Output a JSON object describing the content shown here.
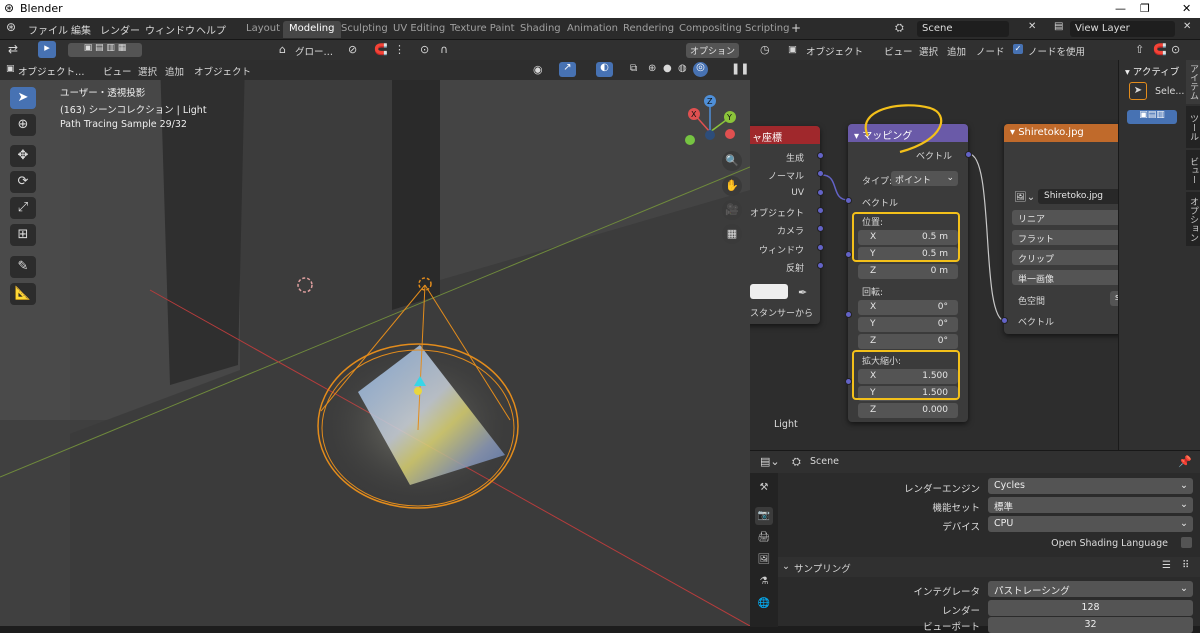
{
  "window": {
    "title": "Blender",
    "min": "—",
    "max": "❐",
    "close": "✕"
  },
  "menus": [
    "ファイル",
    "編集",
    "レンダー",
    "ウィンドウ",
    "ヘルプ"
  ],
  "workspace_tabs": [
    "Layout",
    "Modeling",
    "Sculpting",
    "UV Editing",
    "Texture Paint",
    "Shading",
    "Animation",
    "Rendering",
    "Compositing",
    "Scripting"
  ],
  "active_tab": "Modeling",
  "scene": {
    "name": "Scene",
    "view_layer": "View Layer"
  },
  "viewport": {
    "header": {
      "global_label": "グロー…",
      "options_label": "オプション"
    },
    "mode_menu": {
      "mode": "オブジェクト…",
      "view": "ビュー",
      "select": "選択",
      "add": "追加",
      "object": "オブジェクト"
    },
    "overlay_text": {
      "line1": "ユーザー・透視投影",
      "line2": "(163) シーンコレクション | Light",
      "line3": "Path Tracing Sample 29/32"
    },
    "gizmo": {
      "x": "X",
      "y": "Y",
      "z": "Z"
    }
  },
  "node_editor": {
    "header": {
      "type": "オブジェクト",
      "view": "ビュー",
      "select": "選択",
      "add": "追加",
      "node": "ノード",
      "use_nodes_label": "ノードを使用",
      "use_nodes": true
    },
    "texcoord_node": {
      "title": "ャ座標",
      "outputs": [
        "生成",
        "ノーマル",
        "UV",
        "オブジェクト",
        "カメラ",
        "ウィンドウ",
        "反射"
      ],
      "instancer_label": "スタンサーから"
    },
    "mapping_node": {
      "title": "マッピング",
      "output_vector": "ベクトル",
      "type_label": "タイプ:",
      "type_value": "ポイント",
      "vector_input": "ベクトル",
      "location_label": "位置:",
      "location": [
        {
          "axis": "X",
          "value": "0.5 m"
        },
        {
          "axis": "Y",
          "value": "0.5 m"
        },
        {
          "axis": "Z",
          "value": "0 m"
        }
      ],
      "rotation_label": "回転:",
      "rotation": [
        {
          "axis": "X",
          "value": "0°"
        },
        {
          "axis": "Y",
          "value": "0°"
        },
        {
          "axis": "Z",
          "value": "0°"
        }
      ],
      "scale_label": "拡大縮小:",
      "scale": [
        {
          "axis": "X",
          "value": "1.500"
        },
        {
          "axis": "Y",
          "value": "1.500"
        },
        {
          "axis": "Z",
          "value": "0.000"
        }
      ]
    },
    "image_node": {
      "title": "Shiretoko.jpg",
      "image_name": "Shiretoko.jpg",
      "interpolation": "リニア",
      "projection": "フラット",
      "extension": "クリップ",
      "source": "単一画像",
      "colorspace_label": "色空間",
      "colorspace_value": "s",
      "vector_input": "ベクトル"
    },
    "frame_label": "Light"
  },
  "npanel": {
    "section_title": "アクティブ",
    "select_label": "Sele...",
    "tabs": [
      "アイテム",
      "ツール",
      "ビュー",
      "オプション"
    ]
  },
  "properties": {
    "header_scene": "Scene",
    "rows": [
      {
        "label": "レンダーエンジン",
        "value": "Cycles"
      },
      {
        "label": "機能セット",
        "value": "標準"
      },
      {
        "label": "デバイス",
        "value": "CPU"
      }
    ],
    "osl_label": "Open Shading Language",
    "osl_checked": false,
    "sampling_title": "サンプリング",
    "integrator_label": "インテグレータ",
    "integrator_value": "パストレーシング",
    "render_label": "レンダー",
    "render_value": "128",
    "viewport_label": "ビューポート",
    "viewport_value": "32"
  },
  "colors": {
    "accent": "#4772b3",
    "mapping_header": "#6a5aa8",
    "image_header": "#c06a2b",
    "texcoord_header": "#a0282c",
    "annotation": "#f3c01a",
    "socket_vector": "#6363c7"
  }
}
